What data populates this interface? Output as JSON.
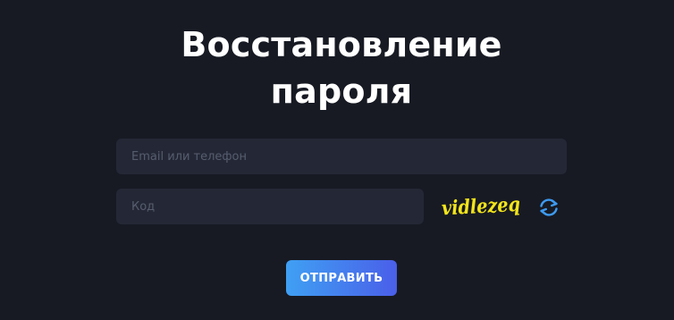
{
  "title": {
    "line1": "Восстановление",
    "line2": "пароля"
  },
  "email_field": {
    "placeholder": "Email или телефон",
    "value": ""
  },
  "code_field": {
    "placeholder": "Код",
    "value": ""
  },
  "captcha": {
    "text": "vidlezeq",
    "color": "#f3e51a",
    "refresh_icon": "refresh-icon",
    "refresh_color": "#3d9af0"
  },
  "submit_button": {
    "label": "ОТПРАВИТЬ"
  },
  "colors": {
    "background": "#171a23",
    "input_background": "#242836",
    "button_gradient_start": "#3fa0f3",
    "button_gradient_end": "#4a5fe9"
  }
}
